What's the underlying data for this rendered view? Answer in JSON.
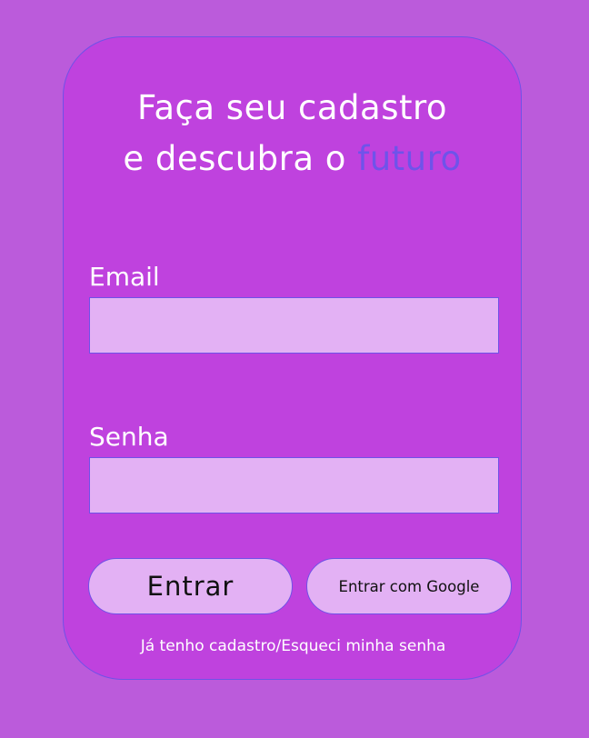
{
  "heading": {
    "line1": "Faça seu cadastro",
    "line2_prefix": "e descubra o ",
    "line2_accent": "futuro"
  },
  "form": {
    "email_label": "Email",
    "email_value": "",
    "senha_label": "Senha",
    "senha_value": ""
  },
  "buttons": {
    "entrar_label": "Entrar",
    "google_label": "Entrar com Google"
  },
  "footer": {
    "link_text": "Já tenho cadastro/Esqueci minha senha"
  },
  "colors": {
    "page_background": "#bb5bdb",
    "card_background": "#bf42de",
    "input_background": "#e3b1f4",
    "accent": "#6f53ea"
  }
}
